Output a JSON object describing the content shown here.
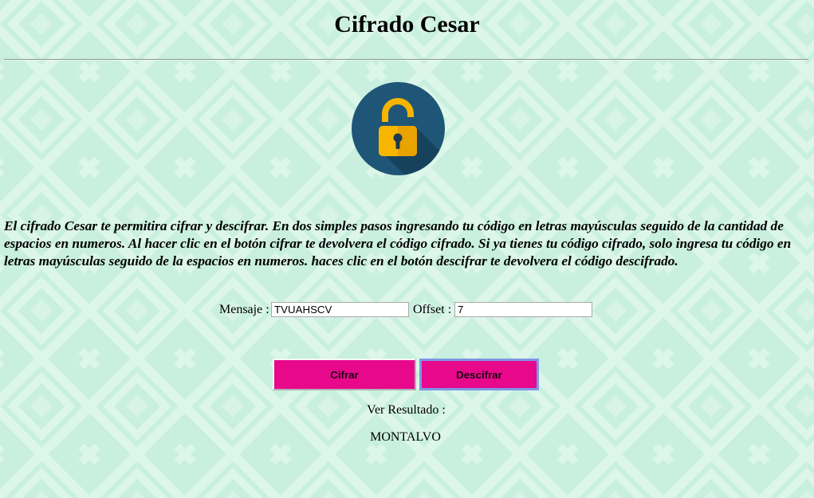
{
  "page": {
    "title": "Cifrado Cesar",
    "description": "El cifrado Cesar te permitira cifrar y descifrar. En dos simples pasos ingresando tu código en letras mayúsculas seguido de la cantidad de espacios en numeros. Al hacer clic en el botón cifrar te devolvera el código cifrado. Si ya tienes tu código cifrado, solo ingresa tu código en letras mayúsculas seguido de la espacios en numeros. haces clic en el botón descifrar te devolvera el código descifrado."
  },
  "icons": {
    "lock": "padlock-open-icon"
  },
  "form": {
    "message_label": "Mensaje :",
    "message_value": "TVUAHSCV",
    "offset_label": "Offset :",
    "offset_value": "7"
  },
  "buttons": {
    "encrypt_label": "Cifrar",
    "decrypt_label": "Descifrar"
  },
  "result": {
    "label": "Ver Resultado :",
    "value": "MONTALVO"
  },
  "colors": {
    "background": "#c9efdf",
    "pattern_light": "#e2f8ee",
    "button": "#e8088c",
    "lock_circle": "#1f5677",
    "lock_body": "#f7b500"
  }
}
